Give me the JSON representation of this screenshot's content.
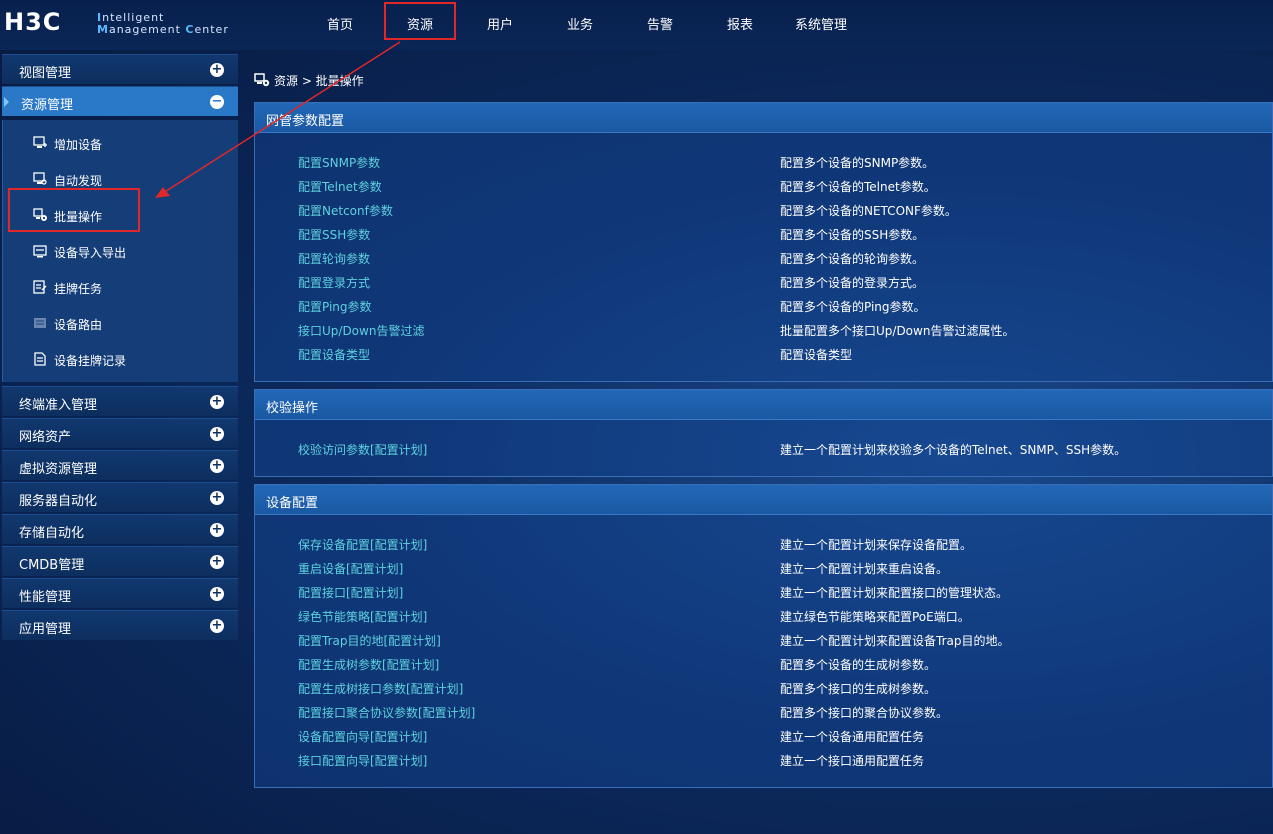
{
  "header": {
    "logo_main": "H3C",
    "logo_line1_initial": "I",
    "logo_line1_rest": "ntelligent",
    "logo_line2_initial1": "M",
    "logo_line2_rest1": "anagement ",
    "logo_line2_initial2": "C",
    "logo_line2_rest2": "enter",
    "nav": [
      "首页",
      "资源",
      "用户",
      "业务",
      "告警",
      "报表",
      "系统管理"
    ]
  },
  "sidebar": {
    "heads_top": [
      "视图管理",
      "资源管理"
    ],
    "sub_items": [
      {
        "label": "增加设备",
        "icon": "add-device-icon"
      },
      {
        "label": "自动发现",
        "icon": "auto-discover-icon"
      },
      {
        "label": "批量操作",
        "icon": "batch-operation-icon"
      },
      {
        "label": "设备导入导出",
        "icon": "import-export-icon"
      },
      {
        "label": "挂牌任务",
        "icon": "tag-task-icon"
      },
      {
        "label": "设备路由",
        "icon": "device-route-icon"
      },
      {
        "label": "设备挂牌记录",
        "icon": "tag-record-icon"
      }
    ],
    "heads_bottom": [
      "终端准入管理",
      "网络资产",
      "虚拟资源管理",
      "服务器自动化",
      "存储自动化",
      "CMDB管理",
      "性能管理",
      "应用管理"
    ]
  },
  "breadcrumb": {
    "text": "资源 > 批量操作"
  },
  "panels": [
    {
      "title": "网管参数配置",
      "rows": [
        {
          "link": "配置SNMP参数",
          "desc": "配置多个设备的SNMP参数。"
        },
        {
          "link": "配置Telnet参数",
          "desc": "配置多个设备的Telnet参数。"
        },
        {
          "link": "配置Netconf参数",
          "desc": "配置多个设备的NETCONF参数。"
        },
        {
          "link": "配置SSH参数",
          "desc": "配置多个设备的SSH参数。"
        },
        {
          "link": "配置轮询参数",
          "desc": "配置多个设备的轮询参数。"
        },
        {
          "link": "配置登录方式",
          "desc": "配置多个设备的登录方式。"
        },
        {
          "link": "配置Ping参数",
          "desc": "配置多个设备的Ping参数。"
        },
        {
          "link": "接口Up/Down告警过滤",
          "desc": "批量配置多个接口Up/Down告警过滤属性。"
        },
        {
          "link": "配置设备类型",
          "desc": "配置设备类型"
        }
      ]
    },
    {
      "title": "校验操作",
      "rows": [
        {
          "link": "校验访问参数[配置计划]",
          "desc": "建立一个配置计划来校验多个设备的Telnet、SNMP、SSH参数。"
        }
      ]
    },
    {
      "title": "设备配置",
      "rows": [
        {
          "link": "保存设备配置[配置计划]",
          "desc": "建立一个配置计划来保存设备配置。"
        },
        {
          "link": "重启设备[配置计划]",
          "desc": "建立一个配置计划来重启设备。"
        },
        {
          "link": "配置接口[配置计划]",
          "desc": "建立一个配置计划来配置接口的管理状态。"
        },
        {
          "link": "绿色节能策略[配置计划]",
          "desc": "建立绿色节能策略来配置PoE端口。"
        },
        {
          "link": "配置Trap目的地[配置计划]",
          "desc": "建立一个配置计划来配置设备Trap目的地。"
        },
        {
          "link": "配置生成树参数[配置计划]",
          "desc": "配置多个设备的生成树参数。"
        },
        {
          "link": "配置生成树接口参数[配置计划]",
          "desc": "配置多个接口的生成树参数。"
        },
        {
          "link": "配置接口聚合协议参数[配置计划]",
          "desc": "配置多个接口的聚合协议参数。"
        },
        {
          "link": "设备配置向导[配置计划]",
          "desc": "建立一个设备通用配置任务"
        },
        {
          "link": "接口配置向导[配置计划]",
          "desc": "建立一个接口通用配置任务"
        }
      ]
    }
  ],
  "colors": {
    "link": "#5ed2e0",
    "highlight_box": "#e0282a",
    "active_menu": "#2a78c8"
  }
}
